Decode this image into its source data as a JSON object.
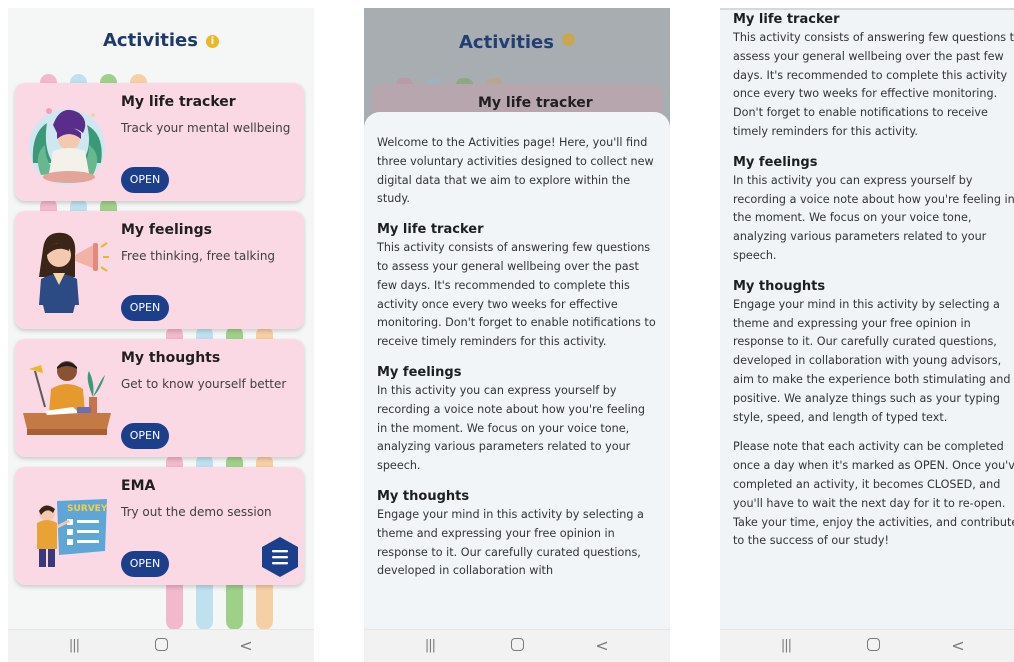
{
  "screen1": {
    "title": "Activities",
    "info_icon": "info-icon",
    "cards": [
      {
        "title": "My life tracker",
        "subtitle": "Track your mental wellbeing",
        "button": "OPEN",
        "illustration": "meditation-illustration"
      },
      {
        "title": "My feelings",
        "subtitle": "Free thinking, free talking",
        "button": "OPEN",
        "illustration": "megaphone-girl-illustration"
      },
      {
        "title": "My thoughts",
        "subtitle": "Get to know yourself better",
        "button": "OPEN",
        "illustration": "writing-desk-illustration"
      },
      {
        "title": "EMA",
        "subtitle": "Try out the demo session",
        "button": "OPEN",
        "illustration": "survey-illustration",
        "survey_label": "SURVEY"
      }
    ],
    "fab_icon": "menu-icon"
  },
  "screen2": {
    "dim_title": "Activities",
    "dim_card_title": "My life tracker",
    "intro": "Welcome to the Activities page! Here, you'll find three voluntary activities designed to collect new digital data that we aim to explore within the study.",
    "sections": [
      {
        "heading": "My life tracker",
        "body": "This activity consists of answering few questions to assess your general wellbeing over the past few days. It's recommended to complete this activity once every two weeks for effective monitoring. Don't forget to enable notifications to receive timely reminders for this activity."
      },
      {
        "heading": "My feelings",
        "body": "In this activity you can express yourself by recording a voice note about how you're feeling in the moment. We focus on your voice tone, analyzing various parameters related to your speech."
      },
      {
        "heading": "My thoughts",
        "body": "Engage your mind in this activity by selecting a theme and expressing your free opinion in response to it. Our carefully curated questions, developed in collaboration with"
      }
    ]
  },
  "screen3": {
    "sections": [
      {
        "heading": "My life tracker",
        "body": "This activity consists of answering few questions to assess your general wellbeing over the past few days. It's recommended to complete this activity once every two weeks for effective monitoring. Don't forget to enable notifications to receive timely reminders for this activity."
      },
      {
        "heading": "My feelings",
        "body": "In this activity you can express yourself by recording a voice note about how you're feeling in the moment. We focus on your voice tone, analyzing various parameters related to your speech."
      },
      {
        "heading": "My thoughts",
        "body": "Engage your mind in this activity by selecting a theme and expressing your free opinion in response to it. Our carefully curated questions, developed in collaboration with young advisors, aim to make the experience both stimulating and positive. We analyze things such as your typing style, speed, and length of typed text."
      }
    ],
    "note": "Please note that each activity can be completed once a day when it's marked as OPEN. Once you've completed an activity, it becomes CLOSED, and you'll have to wait the next day for it to re-open. Take your time, enjoy the activities, and contribute to the success of our study!"
  },
  "navbar": {
    "recents": "|||",
    "home": "home",
    "back": "<"
  },
  "colors": {
    "title_blue": "#1c3a6e",
    "card_pink": "#fad9e5",
    "button_blue": "#1b3f8a",
    "stripe_pink": "#f2b8cc",
    "stripe_blue": "#bfe0ef",
    "stripe_green": "#9fd08a",
    "stripe_peach": "#f6cfa5"
  }
}
